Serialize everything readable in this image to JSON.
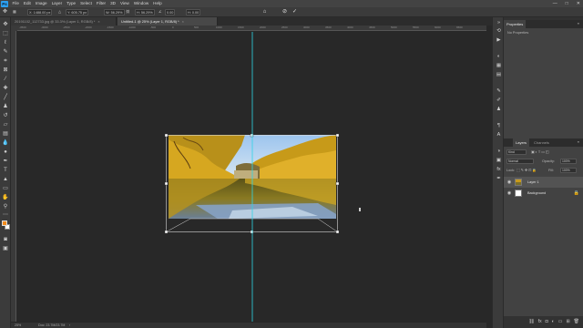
{
  "app": {
    "logo": "Ps",
    "menu": [
      "File",
      "Edit",
      "Image",
      "Layer",
      "Type",
      "Select",
      "Filter",
      "3D",
      "View",
      "Window",
      "Help"
    ],
    "window_controls": [
      "—",
      "□",
      "✕"
    ]
  },
  "options": {
    "x_field": "X: 1488.00 px",
    "y_field": "Y: 605.75 px",
    "w_field": "W: 56.29%",
    "h_field": "H: 56.29%",
    "angle_field": "0.00",
    "h_skew": "H: 0.00",
    "interp": "Bicubic",
    "cancel_icon": "cancel-icon",
    "commit_icon": "commit-icon"
  },
  "tabs": [
    {
      "label": "20191102_112733.jpg @ 33.3% (Layer 1, RGB/8) *",
      "active": false
    },
    {
      "label": "Untitled-1 @ 25% (Layer 1, RGB/8) *",
      "active": true
    }
  ],
  "ruler": {
    "ticks": [
      "-3500",
      "-3000",
      "-2500",
      "-2000",
      "-1500",
      "-1000",
      "-500",
      "0",
      "500",
      "1000",
      "1500",
      "2000",
      "2500",
      "3000",
      "3500",
      "4000",
      "4500",
      "5000",
      "5500",
      "6000",
      "6500"
    ]
  },
  "status": {
    "zoom": "25%",
    "doc": "Doc: 23.7M/23.7M"
  },
  "panels": {
    "properties_tab": "Properties",
    "no_properties": "No Properties",
    "layers_tab": "Layers",
    "channels_tab": "Channels",
    "kind_filter": "Kind",
    "blend_mode": "Normal",
    "opacity_label": "Opacity:",
    "opacity_value": "100%",
    "lock_label": "Lock:",
    "fill_label": "Fill:",
    "fill_value": "100%",
    "layers": [
      {
        "name": "Layer 1",
        "selected": true
      },
      {
        "name": "Background",
        "selected": false
      }
    ]
  },
  "colors": {
    "foreground": "#f28c1e",
    "background": "#ffffff",
    "guide": "#2fd6e6",
    "accent": "#2da0f0"
  }
}
